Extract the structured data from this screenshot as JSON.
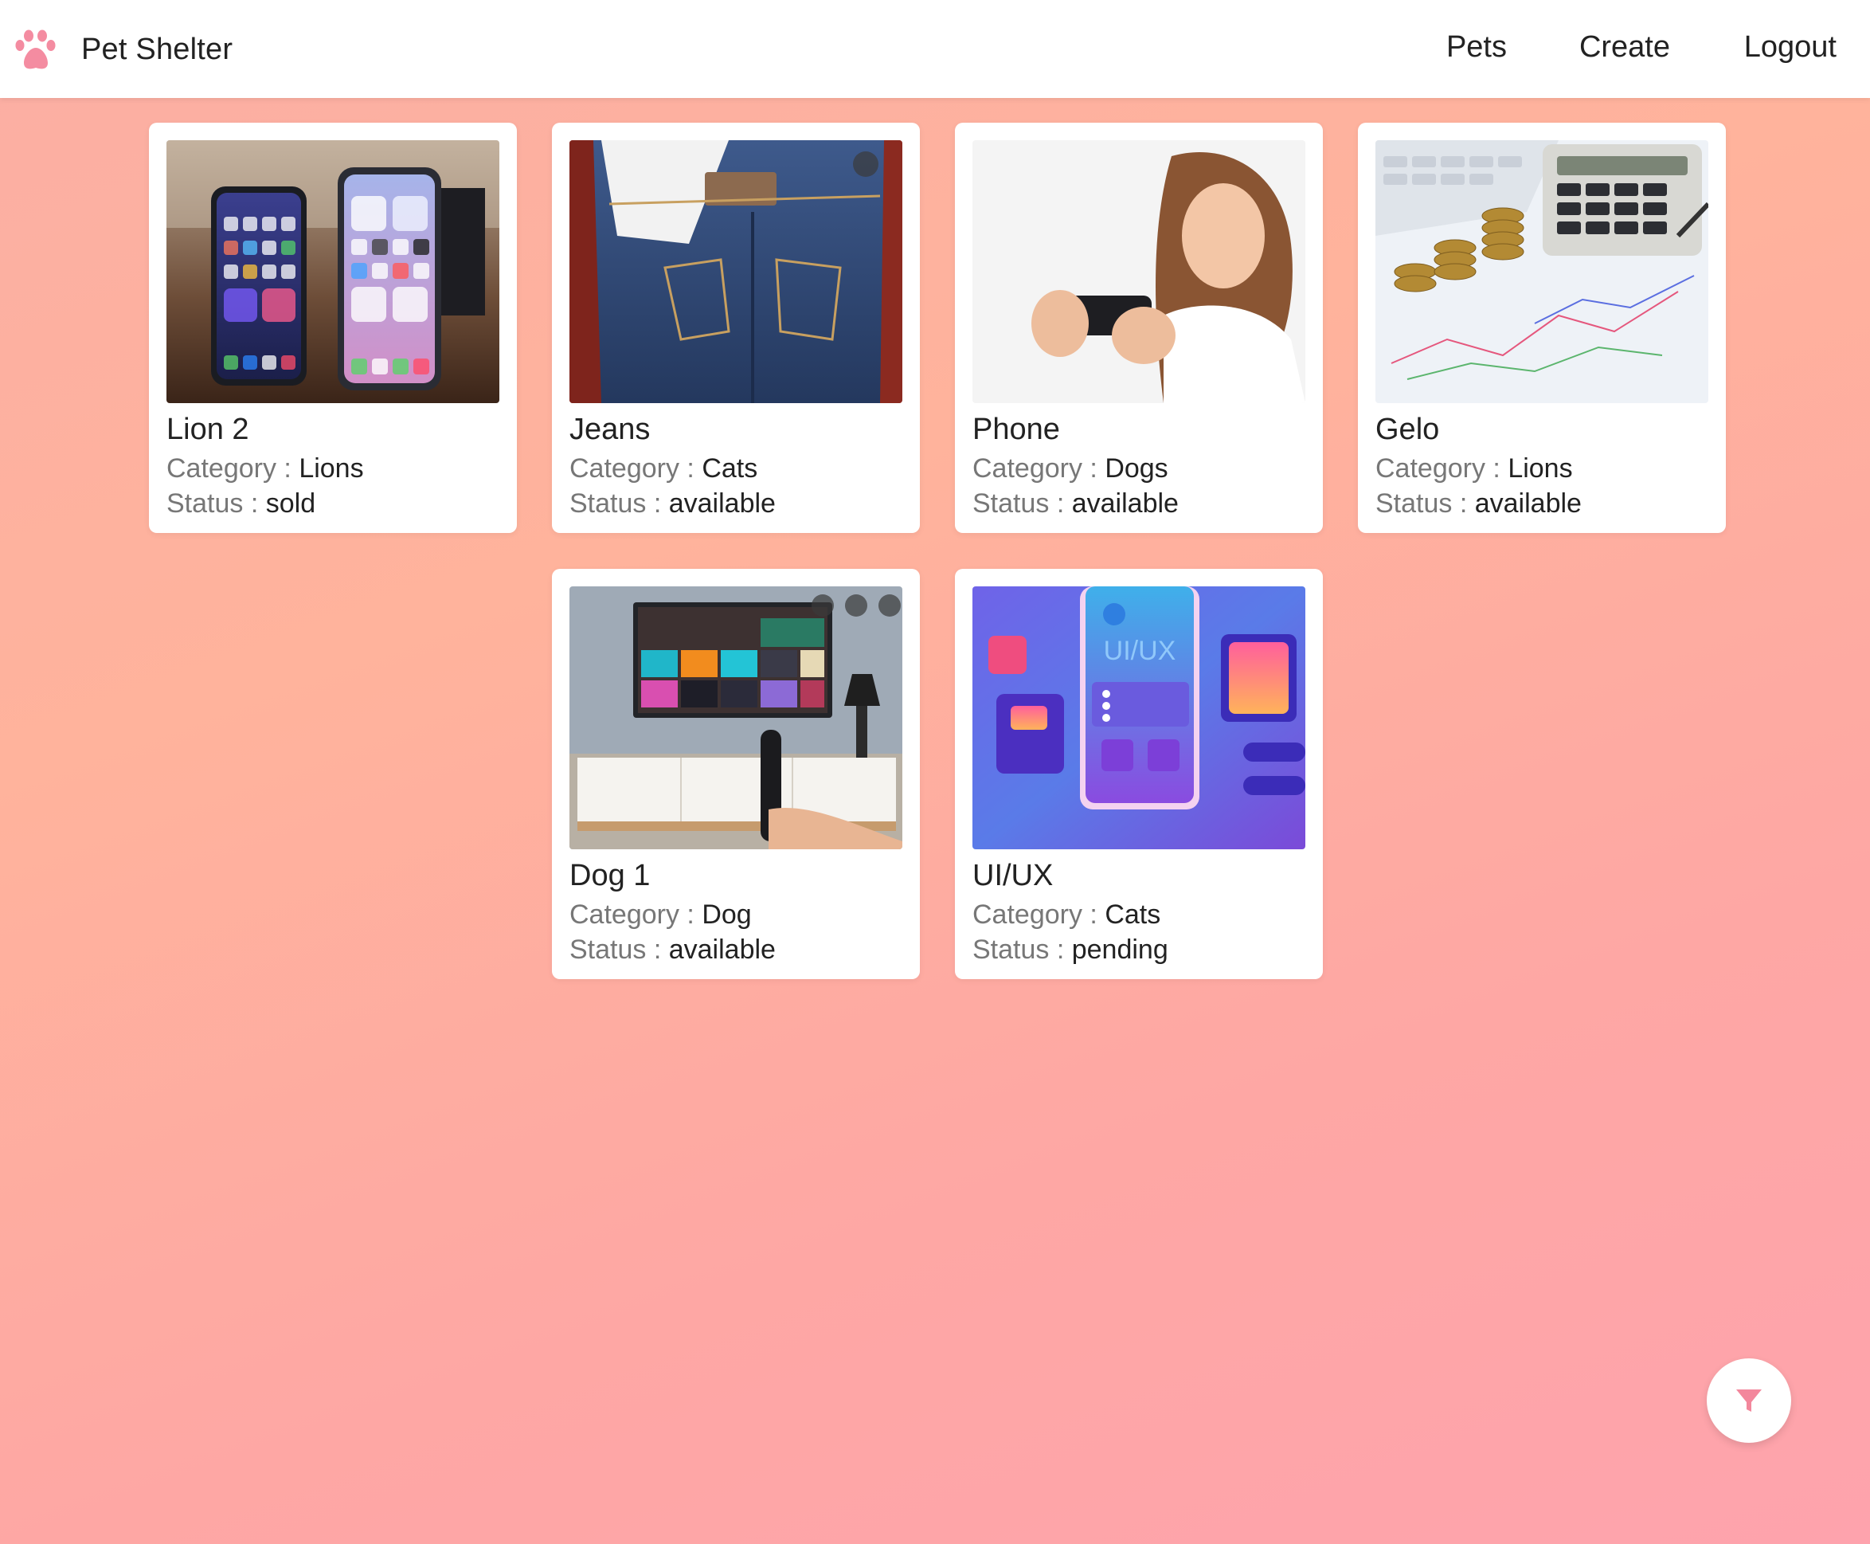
{
  "app": {
    "title": "Pet Shelter",
    "logo_icon": "paw-icon",
    "accent_color": "#f3879c"
  },
  "nav": {
    "pets": "Pets",
    "create": "Create",
    "logout": "Logout"
  },
  "labels": {
    "category": "Category :",
    "status": "Status :"
  },
  "pets": [
    {
      "name": "Lion 2",
      "category": "Lions",
      "status": "sold",
      "image": "two smartphones on a table"
    },
    {
      "name": "Jeans",
      "category": "Cats",
      "status": "available",
      "image": "blue denim jeans"
    },
    {
      "name": "Phone",
      "category": "Dogs",
      "status": "available",
      "image": "woman holding a phone"
    },
    {
      "name": "Gelo",
      "category": "Lions",
      "status": "available",
      "image": "calculator and coins"
    },
    {
      "name": "Dog 1",
      "category": "Dog",
      "status": "available",
      "image": "tv on a wall with remote"
    },
    {
      "name": "UI/UX",
      "category": "Cats",
      "status": "pending",
      "image": "ui/ux illustration"
    }
  ],
  "filter_button": {
    "icon": "filter-icon"
  }
}
